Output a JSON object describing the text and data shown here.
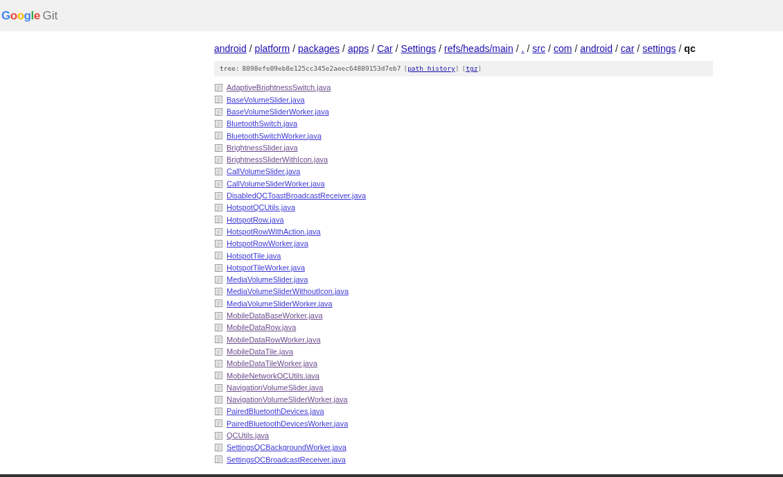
{
  "header": {
    "logo_brand": "Google",
    "logo_product": "Git"
  },
  "breadcrumb": {
    "separator": "/",
    "items": [
      {
        "label": "android",
        "kind": "link"
      },
      {
        "label": "platform",
        "kind": "link"
      },
      {
        "label": "packages",
        "kind": "link"
      },
      {
        "label": "apps",
        "kind": "link"
      },
      {
        "label": "Car",
        "kind": "link"
      },
      {
        "label": "Settings",
        "kind": "link"
      },
      {
        "label": "refs/heads/main",
        "kind": "link"
      },
      {
        "label": ".",
        "kind": "link"
      },
      {
        "label": "src",
        "kind": "link"
      },
      {
        "label": "com",
        "kind": "link"
      },
      {
        "label": "android",
        "kind": "link"
      },
      {
        "label": "car",
        "kind": "link"
      },
      {
        "label": "settings",
        "kind": "link"
      },
      {
        "label": "qc",
        "kind": "current"
      }
    ]
  },
  "tree_info": {
    "label": "tree:",
    "hash": "8098efe09eb8e125cc345e2aeec64889153d7eb7",
    "open": "[",
    "close": "]",
    "links": [
      "path history",
      "tgz"
    ]
  },
  "files": [
    {
      "name": "AdaptiveBrightnessSwitch.java",
      "visited": true
    },
    {
      "name": "BaseVolumeSlider.java",
      "visited": false
    },
    {
      "name": "BaseVolumeSliderWorker.java",
      "visited": false
    },
    {
      "name": "BluetoothSwitch.java",
      "visited": false
    },
    {
      "name": "BluetoothSwitchWorker.java",
      "visited": false
    },
    {
      "name": "BrightnessSlider.java",
      "visited": true
    },
    {
      "name": "BrightnessSliderWithIcon.java",
      "visited": true
    },
    {
      "name": "CallVolumeSlider.java",
      "visited": false
    },
    {
      "name": "CallVolumeSliderWorker.java",
      "visited": false
    },
    {
      "name": "DisabledQCToastBroadcastReceiver.java",
      "visited": false
    },
    {
      "name": "HotspotQCUtils.java",
      "visited": false
    },
    {
      "name": "HotspotRow.java",
      "visited": false
    },
    {
      "name": "HotspotRowWithAction.java",
      "visited": false
    },
    {
      "name": "HotspotRowWorker.java",
      "visited": false
    },
    {
      "name": "HotspotTile.java",
      "visited": false
    },
    {
      "name": "HotspotTileWorker.java",
      "visited": false
    },
    {
      "name": "MediaVolumeSlider.java",
      "visited": false
    },
    {
      "name": "MediaVolumeSliderWithoutIcon.java",
      "visited": false
    },
    {
      "name": "MediaVolumeSliderWorker.java",
      "visited": false
    },
    {
      "name": "MobileDataBaseWorker.java",
      "visited": true
    },
    {
      "name": "MobileDataRow.java",
      "visited": true
    },
    {
      "name": "MobileDataRowWorker.java",
      "visited": true
    },
    {
      "name": "MobileDataTile.java",
      "visited": true
    },
    {
      "name": "MobileDataTileWorker.java",
      "visited": true
    },
    {
      "name": "MobileNetworkQCUtils.java",
      "visited": true
    },
    {
      "name": "NavigationVolumeSlider.java",
      "visited": true
    },
    {
      "name": "NavigationVolumeSliderWorker.java",
      "visited": true
    },
    {
      "name": "PairedBluetoothDevices.java",
      "visited": false
    },
    {
      "name": "PairedBluetoothDevicesWorker.java",
      "visited": false
    },
    {
      "name": "QCUtils.java",
      "visited": true
    },
    {
      "name": "SettingsQCBackgroundWorker.java",
      "visited": false
    },
    {
      "name": "SettingsQCBroadcastReceiver.java",
      "visited": false
    }
  ]
}
